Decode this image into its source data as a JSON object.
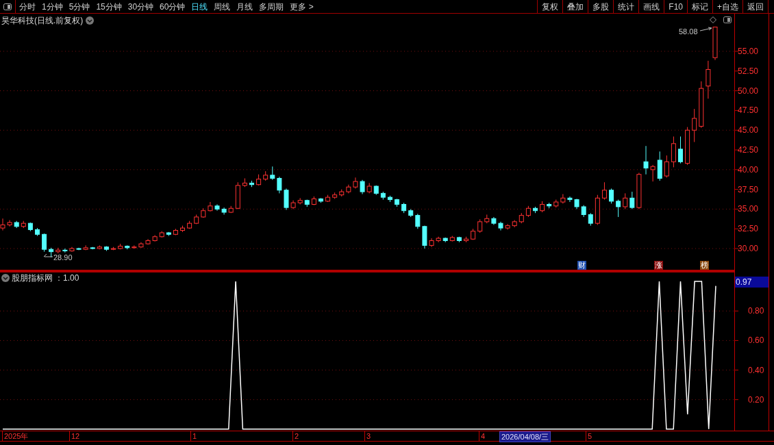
{
  "toolbar": {
    "tabs": [
      {
        "label": "分时",
        "selected": false
      },
      {
        "label": "1分钟",
        "selected": false
      },
      {
        "label": "5分钟",
        "selected": false
      },
      {
        "label": "15分钟",
        "selected": false
      },
      {
        "label": "30分钟",
        "selected": false
      },
      {
        "label": "60分钟",
        "selected": false
      },
      {
        "label": "日线",
        "selected": true
      },
      {
        "label": "周线",
        "selected": false
      },
      {
        "label": "月线",
        "selected": false
      },
      {
        "label": "多周期",
        "selected": false
      },
      {
        "label": "更多 >",
        "selected": false
      }
    ],
    "buttons": [
      "复权",
      "叠加",
      "多股",
      "统计",
      "画线",
      "F10",
      "标记",
      "+自选",
      "返回"
    ]
  },
  "main_chart": {
    "title": "昊华科技(日线.前复权)",
    "high_label": "58.08",
    "low_label": "28.90",
    "badges": [
      {
        "text": "财",
        "color": "#1f4fb0"
      },
      {
        "text": "涨",
        "color": "#8a1010"
      },
      {
        "text": "榜",
        "color": "#8a4a10"
      }
    ],
    "chart_data": {
      "type": "candlestick",
      "ylim": [
        27.14,
        59.77
      ],
      "grid": true,
      "yticks": [
        {
          "value": 55,
          "label": "55.00"
        },
        {
          "value": 52.5,
          "label": "52.50"
        },
        {
          "value": 50,
          "label": "50.00"
        },
        {
          "value": 47.5,
          "label": "47.50"
        },
        {
          "value": 45,
          "label": "45.00"
        },
        {
          "value": 42.5,
          "label": "42.50"
        },
        {
          "value": 40,
          "label": "40.00"
        },
        {
          "value": 37.5,
          "label": "37.50"
        },
        {
          "value": 35,
          "label": "35.00"
        },
        {
          "value": 32.5,
          "label": "32.50"
        },
        {
          "value": 30,
          "label": "30.00"
        }
      ],
      "ohlc": [
        [
          32.6,
          33.8,
          32.3,
          33.0
        ],
        [
          33.0,
          33.6,
          32.8,
          33.3
        ],
        [
          33.3,
          33.5,
          32.6,
          32.8
        ],
        [
          32.8,
          33.5,
          32.6,
          33.2
        ],
        [
          33.2,
          33.3,
          32.2,
          32.4
        ],
        [
          32.4,
          32.6,
          31.6,
          31.8
        ],
        [
          31.8,
          31.9,
          29.6,
          29.9
        ],
        [
          29.9,
          30.1,
          28.9,
          29.6
        ],
        [
          29.6,
          30.1,
          29.4,
          29.8
        ],
        [
          29.8,
          30.0,
          29.5,
          29.7
        ],
        [
          29.7,
          30.2,
          29.6,
          30.0
        ],
        [
          30.0,
          30.1,
          29.8,
          29.9
        ],
        [
          29.9,
          30.4,
          29.8,
          30.1
        ],
        [
          30.1,
          30.2,
          29.9,
          30.0
        ],
        [
          30.0,
          30.4,
          29.9,
          30.2
        ],
        [
          30.2,
          30.3,
          29.7,
          29.9
        ],
        [
          29.9,
          30.2,
          29.8,
          30.0
        ],
        [
          30.0,
          30.6,
          29.9,
          30.3
        ],
        [
          30.3,
          30.4,
          29.9,
          30.1
        ],
        [
          30.1,
          30.4,
          30.0,
          30.2
        ],
        [
          30.2,
          30.8,
          30.1,
          30.6
        ],
        [
          30.6,
          31.2,
          30.5,
          31.0
        ],
        [
          31.0,
          31.7,
          30.9,
          31.5
        ],
        [
          31.5,
          32.2,
          31.4,
          32.0
        ],
        [
          32.0,
          32.1,
          31.6,
          31.8
        ],
        [
          31.8,
          32.5,
          31.7,
          32.3
        ],
        [
          32.3,
          32.9,
          32.1,
          32.6
        ],
        [
          32.6,
          33.5,
          32.5,
          33.2
        ],
        [
          33.2,
          34.3,
          33.1,
          34.0
        ],
        [
          34.0,
          35.1,
          33.9,
          34.8
        ],
        [
          34.8,
          35.9,
          34.7,
          35.4
        ],
        [
          35.4,
          35.6,
          34.8,
          35.0
        ],
        [
          35.0,
          35.2,
          34.3,
          34.6
        ],
        [
          34.6,
          35.4,
          34.5,
          35.1
        ],
        [
          35.1,
          38.4,
          35.0,
          38.0
        ],
        [
          38.0,
          38.9,
          37.8,
          38.3
        ],
        [
          38.3,
          38.6,
          37.8,
          38.1
        ],
        [
          38.1,
          39.4,
          38.0,
          38.8
        ],
        [
          38.8,
          39.8,
          38.6,
          39.3
        ],
        [
          39.3,
          40.4,
          38.7,
          38.9
        ],
        [
          38.9,
          39.1,
          37.0,
          37.4
        ],
        [
          37.4,
          37.6,
          34.9,
          35.2
        ],
        [
          35.2,
          36.1,
          35.0,
          35.8
        ],
        [
          35.8,
          36.4,
          35.6,
          36.1
        ],
        [
          36.1,
          36.2,
          35.3,
          35.6
        ],
        [
          35.6,
          36.6,
          35.5,
          36.3
        ],
        [
          36.3,
          36.4,
          35.8,
          36.0
        ],
        [
          36.0,
          36.8,
          35.9,
          36.5
        ],
        [
          36.5,
          37.1,
          36.3,
          36.8
        ],
        [
          36.8,
          37.5,
          36.6,
          37.2
        ],
        [
          37.2,
          38.1,
          37.0,
          37.8
        ],
        [
          37.8,
          39.0,
          37.6,
          38.5
        ],
        [
          38.5,
          38.7,
          36.9,
          37.2
        ],
        [
          37.2,
          38.3,
          37.0,
          37.9
        ],
        [
          37.9,
          38.0,
          36.8,
          37.0
        ],
        [
          37.0,
          37.2,
          36.2,
          36.5
        ],
        [
          36.5,
          36.7,
          35.9,
          36.2
        ],
        [
          36.2,
          36.3,
          35.3,
          35.6
        ],
        [
          35.6,
          35.8,
          34.5,
          34.8
        ],
        [
          34.8,
          35.0,
          34.0,
          34.2
        ],
        [
          34.2,
          34.4,
          32.5,
          32.8
        ],
        [
          32.8,
          32.9,
          30.0,
          30.4
        ],
        [
          30.4,
          31.3,
          30.2,
          31.0
        ],
        [
          31.0,
          31.5,
          30.8,
          31.3
        ],
        [
          31.3,
          31.4,
          30.8,
          31.0
        ],
        [
          31.0,
          31.6,
          30.9,
          31.4
        ],
        [
          31.4,
          31.5,
          30.8,
          31.0
        ],
        [
          31.0,
          31.5,
          30.8,
          31.2
        ],
        [
          31.2,
          32.5,
          31.1,
          32.2
        ],
        [
          32.2,
          33.7,
          32.0,
          33.4
        ],
        [
          33.4,
          34.3,
          33.2,
          33.8
        ],
        [
          33.8,
          34.0,
          33.0,
          33.2
        ],
        [
          33.2,
          33.4,
          32.3,
          32.6
        ],
        [
          32.6,
          33.1,
          32.4,
          32.9
        ],
        [
          32.9,
          33.6,
          32.7,
          33.4
        ],
        [
          33.4,
          34.5,
          33.2,
          34.2
        ],
        [
          34.2,
          35.4,
          34.0,
          35.1
        ],
        [
          35.1,
          35.3,
          34.5,
          34.8
        ],
        [
          34.8,
          36.0,
          34.6,
          35.6
        ],
        [
          35.6,
          35.8,
          35.1,
          35.4
        ],
        [
          35.4,
          36.2,
          35.2,
          35.9
        ],
        [
          35.9,
          36.9,
          35.7,
          36.4
        ],
        [
          36.4,
          36.6,
          35.9,
          36.2
        ],
        [
          36.2,
          36.3,
          35.0,
          35.3
        ],
        [
          35.3,
          35.5,
          34.0,
          34.3
        ],
        [
          34.3,
          34.5,
          32.9,
          33.2
        ],
        [
          33.2,
          36.8,
          33.0,
          36.4
        ],
        [
          36.4,
          38.4,
          36.2,
          37.4
        ],
        [
          37.4,
          37.6,
          35.7,
          36.0
        ],
        [
          36.0,
          36.2,
          34.0,
          35.3
        ],
        [
          35.3,
          37.0,
          35.0,
          36.4
        ],
        [
          36.4,
          37.2,
          35.0,
          35.2
        ],
        [
          35.2,
          39.6,
          35.0,
          39.4
        ],
        [
          41.0,
          43.0,
          39.4,
          40.2
        ],
        [
          40.0,
          40.6,
          38.5,
          40.4
        ],
        [
          41.2,
          42.3,
          38.6,
          38.9
        ],
        [
          39.2,
          41.8,
          39.0,
          41.0
        ],
        [
          41.0,
          44.2,
          40.3,
          43.3
        ],
        [
          42.6,
          44.2,
          40.8,
          41.0
        ],
        [
          40.8,
          45.4,
          40.6,
          45.0
        ],
        [
          45.0,
          47.7,
          43.5,
          46.5
        ],
        [
          45.5,
          51.2,
          45.3,
          50.3
        ],
        [
          50.6,
          53.8,
          49.0,
          52.7
        ],
        [
          54.2,
          58.08,
          53.9,
          58.08
        ]
      ]
    }
  },
  "indicator": {
    "name": "股朋指标网",
    "value_text": "：1.00",
    "current": "0.97",
    "chart_data": {
      "type": "line",
      "ylim": [
        -0.01,
        1.07
      ],
      "grid": true,
      "yticks": [
        {
          "value": 0.8,
          "label": "0.80"
        },
        {
          "value": 0.6,
          "label": "0.60"
        },
        {
          "value": 0.4,
          "label": "0.40"
        },
        {
          "value": 0.2,
          "label": "0.20"
        }
      ],
      "series": [
        {
          "color": "#ffffff",
          "values": [
            0,
            0,
            0,
            0,
            0,
            0,
            0,
            0,
            0,
            0,
            0,
            0,
            0,
            0,
            0,
            0,
            0,
            0,
            0,
            0,
            0,
            0,
            0,
            0,
            0,
            0,
            0,
            0,
            0,
            0,
            0,
            0,
            0,
            1,
            0,
            0,
            0,
            0,
            0,
            0,
            0,
            0,
            0,
            0,
            0,
            0,
            0,
            0,
            0,
            0,
            0,
            0,
            0,
            0,
            0,
            0,
            0,
            0,
            0,
            0,
            0,
            0,
            0,
            0,
            0,
            0,
            0,
            0,
            0,
            0,
            0,
            0,
            0,
            0,
            0,
            0,
            0,
            0,
            0,
            0,
            0,
            0,
            0,
            0,
            0,
            0,
            0,
            0,
            0,
            0,
            0,
            0,
            0,
            1,
            0,
            0,
            1,
            0.1,
            1,
            1,
            0,
            0.97
          ]
        }
      ]
    }
  },
  "date_axis": [
    {
      "text": "2025年",
      "selected": false
    },
    {
      "text": "12",
      "selected": false
    },
    {
      "text": "1",
      "selected": false
    },
    {
      "text": "2",
      "selected": false
    },
    {
      "text": "3",
      "selected": false
    },
    {
      "text": "4",
      "selected": false
    },
    {
      "text": "2026/04/08/三",
      "selected": true
    },
    {
      "text": "5",
      "selected": false
    }
  ]
}
